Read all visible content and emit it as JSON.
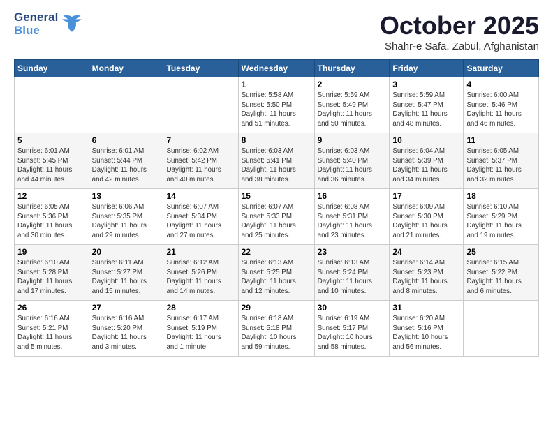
{
  "header": {
    "logo_general": "General",
    "logo_blue": "Blue",
    "month": "October 2025",
    "location": "Shahr-e Safa, Zabul, Afghanistan"
  },
  "weekdays": [
    "Sunday",
    "Monday",
    "Tuesday",
    "Wednesday",
    "Thursday",
    "Friday",
    "Saturday"
  ],
  "weeks": [
    [
      {
        "day": "",
        "detail": ""
      },
      {
        "day": "",
        "detail": ""
      },
      {
        "day": "",
        "detail": ""
      },
      {
        "day": "1",
        "detail": "Sunrise: 5:58 AM\nSunset: 5:50 PM\nDaylight: 11 hours\nand 51 minutes."
      },
      {
        "day": "2",
        "detail": "Sunrise: 5:59 AM\nSunset: 5:49 PM\nDaylight: 11 hours\nand 50 minutes."
      },
      {
        "day": "3",
        "detail": "Sunrise: 5:59 AM\nSunset: 5:47 PM\nDaylight: 11 hours\nand 48 minutes."
      },
      {
        "day": "4",
        "detail": "Sunrise: 6:00 AM\nSunset: 5:46 PM\nDaylight: 11 hours\nand 46 minutes."
      }
    ],
    [
      {
        "day": "5",
        "detail": "Sunrise: 6:01 AM\nSunset: 5:45 PM\nDaylight: 11 hours\nand 44 minutes."
      },
      {
        "day": "6",
        "detail": "Sunrise: 6:01 AM\nSunset: 5:44 PM\nDaylight: 11 hours\nand 42 minutes."
      },
      {
        "day": "7",
        "detail": "Sunrise: 6:02 AM\nSunset: 5:42 PM\nDaylight: 11 hours\nand 40 minutes."
      },
      {
        "day": "8",
        "detail": "Sunrise: 6:03 AM\nSunset: 5:41 PM\nDaylight: 11 hours\nand 38 minutes."
      },
      {
        "day": "9",
        "detail": "Sunrise: 6:03 AM\nSunset: 5:40 PM\nDaylight: 11 hours\nand 36 minutes."
      },
      {
        "day": "10",
        "detail": "Sunrise: 6:04 AM\nSunset: 5:39 PM\nDaylight: 11 hours\nand 34 minutes."
      },
      {
        "day": "11",
        "detail": "Sunrise: 6:05 AM\nSunset: 5:37 PM\nDaylight: 11 hours\nand 32 minutes."
      }
    ],
    [
      {
        "day": "12",
        "detail": "Sunrise: 6:05 AM\nSunset: 5:36 PM\nDaylight: 11 hours\nand 30 minutes."
      },
      {
        "day": "13",
        "detail": "Sunrise: 6:06 AM\nSunset: 5:35 PM\nDaylight: 11 hours\nand 29 minutes."
      },
      {
        "day": "14",
        "detail": "Sunrise: 6:07 AM\nSunset: 5:34 PM\nDaylight: 11 hours\nand 27 minutes."
      },
      {
        "day": "15",
        "detail": "Sunrise: 6:07 AM\nSunset: 5:33 PM\nDaylight: 11 hours\nand 25 minutes."
      },
      {
        "day": "16",
        "detail": "Sunrise: 6:08 AM\nSunset: 5:31 PM\nDaylight: 11 hours\nand 23 minutes."
      },
      {
        "day": "17",
        "detail": "Sunrise: 6:09 AM\nSunset: 5:30 PM\nDaylight: 11 hours\nand 21 minutes."
      },
      {
        "day": "18",
        "detail": "Sunrise: 6:10 AM\nSunset: 5:29 PM\nDaylight: 11 hours\nand 19 minutes."
      }
    ],
    [
      {
        "day": "19",
        "detail": "Sunrise: 6:10 AM\nSunset: 5:28 PM\nDaylight: 11 hours\nand 17 minutes."
      },
      {
        "day": "20",
        "detail": "Sunrise: 6:11 AM\nSunset: 5:27 PM\nDaylight: 11 hours\nand 15 minutes."
      },
      {
        "day": "21",
        "detail": "Sunrise: 6:12 AM\nSunset: 5:26 PM\nDaylight: 11 hours\nand 14 minutes."
      },
      {
        "day": "22",
        "detail": "Sunrise: 6:13 AM\nSunset: 5:25 PM\nDaylight: 11 hours\nand 12 minutes."
      },
      {
        "day": "23",
        "detail": "Sunrise: 6:13 AM\nSunset: 5:24 PM\nDaylight: 11 hours\nand 10 minutes."
      },
      {
        "day": "24",
        "detail": "Sunrise: 6:14 AM\nSunset: 5:23 PM\nDaylight: 11 hours\nand 8 minutes."
      },
      {
        "day": "25",
        "detail": "Sunrise: 6:15 AM\nSunset: 5:22 PM\nDaylight: 11 hours\nand 6 minutes."
      }
    ],
    [
      {
        "day": "26",
        "detail": "Sunrise: 6:16 AM\nSunset: 5:21 PM\nDaylight: 11 hours\nand 5 minutes."
      },
      {
        "day": "27",
        "detail": "Sunrise: 6:16 AM\nSunset: 5:20 PM\nDaylight: 11 hours\nand 3 minutes."
      },
      {
        "day": "28",
        "detail": "Sunrise: 6:17 AM\nSunset: 5:19 PM\nDaylight: 11 hours\nand 1 minute."
      },
      {
        "day": "29",
        "detail": "Sunrise: 6:18 AM\nSunset: 5:18 PM\nDaylight: 10 hours\nand 59 minutes."
      },
      {
        "day": "30",
        "detail": "Sunrise: 6:19 AM\nSunset: 5:17 PM\nDaylight: 10 hours\nand 58 minutes."
      },
      {
        "day": "31",
        "detail": "Sunrise: 6:20 AM\nSunset: 5:16 PM\nDaylight: 10 hours\nand 56 minutes."
      },
      {
        "day": "",
        "detail": ""
      }
    ]
  ]
}
